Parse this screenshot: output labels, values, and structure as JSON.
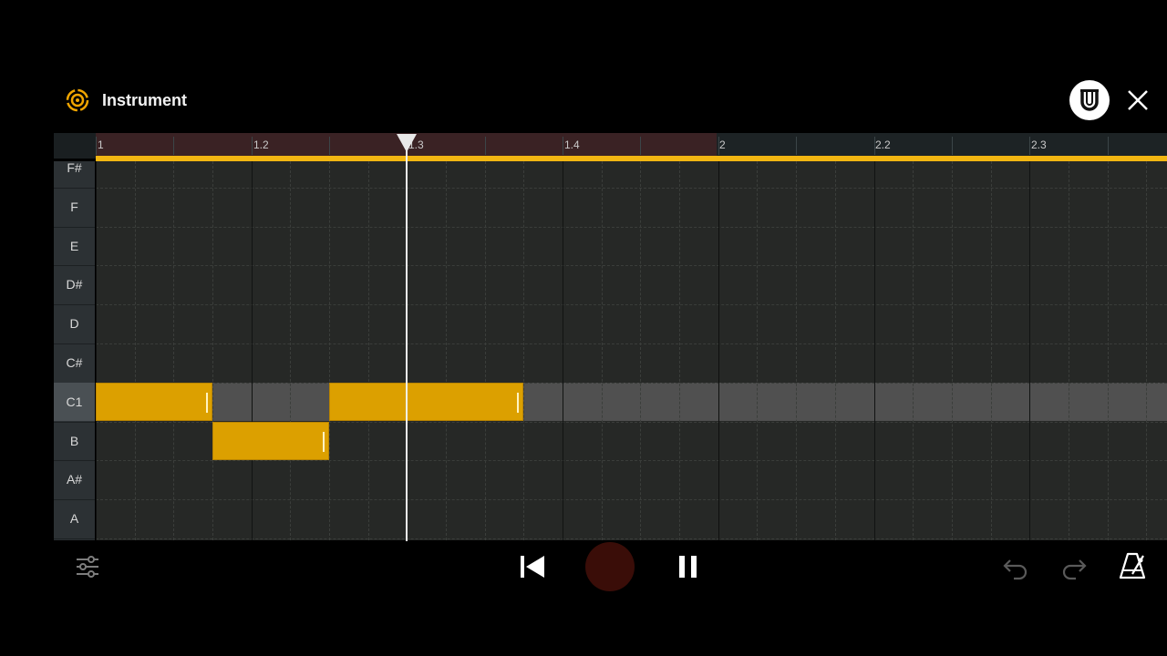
{
  "header": {
    "title": "Instrument",
    "icon": "instrument-icon",
    "magnet_icon": "magnet-snap-icon",
    "close_icon": "close-icon"
  },
  "ruler": {
    "labels": [
      "1",
      "1.2",
      "1.3",
      "1.4",
      "2",
      "2.2",
      "2.3"
    ]
  },
  "piano_keys": [
    "F#",
    "F",
    "E",
    "D#",
    "D",
    "C#",
    "C1",
    "B",
    "A#",
    "A"
  ],
  "highlighted_key": "C1",
  "notes": [
    {
      "pitch": "C1",
      "start_beat": 1,
      "length_beats": 0.75
    },
    {
      "pitch": "B",
      "start_beat": 1.75,
      "length_beats": 0.75
    },
    {
      "pitch": "C1",
      "start_beat": 2.5,
      "length_beats": 0.75
    },
    {
      "pitch": "C1",
      "start_beat": 3.0,
      "length_beats": 0.75
    }
  ],
  "playhead_beat": 3.0,
  "loop": {
    "start": "1",
    "end": "2"
  },
  "transport": {
    "mixer_icon": "mixer-sliders-icon",
    "rewind_icon": "skip-to-start-icon",
    "record_icon": "record-icon",
    "pause_icon": "pause-icon",
    "undo_icon": "undo-icon",
    "redo_icon": "redo-icon",
    "metronome_icon": "metronome-icon"
  },
  "colors": {
    "note": "#dca000",
    "loop_bar": "#f2b612",
    "accent_icon": "#f0a500",
    "record": "#3a0d08"
  }
}
